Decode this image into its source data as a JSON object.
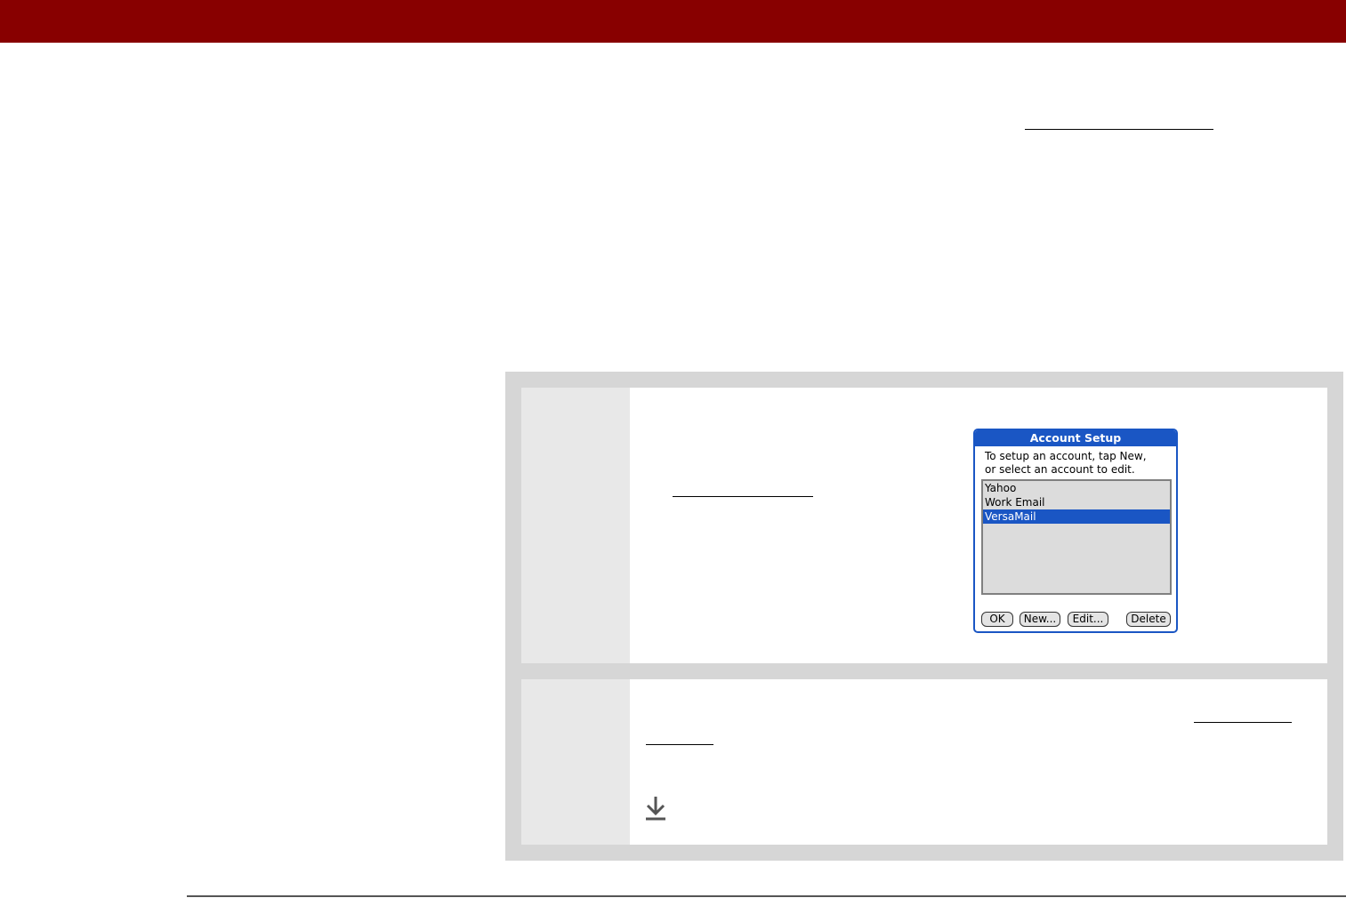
{
  "dialog": {
    "title": "Account Setup",
    "instruction_line1": "To setup an account, tap New,",
    "instruction_line2": "or select an account to edit.",
    "accounts": [
      "Yahoo",
      "Work Email",
      "VersaMail"
    ],
    "selected_account": "VersaMail",
    "buttons": {
      "ok": "OK",
      "new": "New...",
      "edit": "Edit...",
      "delete": "Delete"
    }
  },
  "colors": {
    "top_bar": "#880000",
    "dialog_accent": "#1a56c4",
    "step_frame": "#d6d6d6"
  },
  "icons": {
    "step_continue": "down-arrow-icon"
  }
}
